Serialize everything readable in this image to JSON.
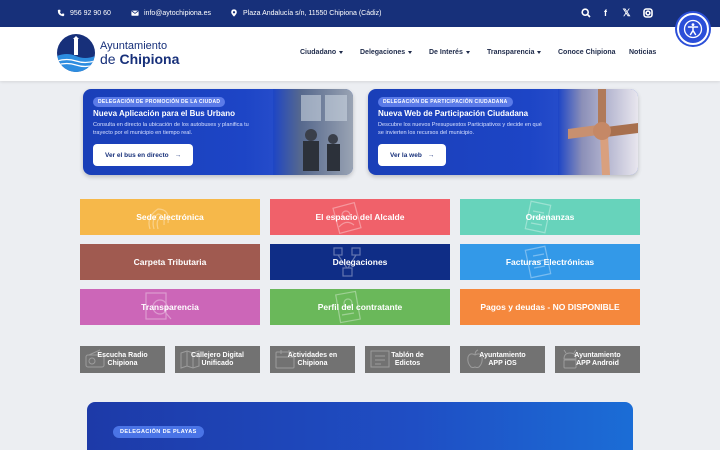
{
  "topbar": {
    "phone": "956 92 90 60",
    "email": "info@aytochipiona.es",
    "address": "Plaza Andalucía s/n, 11550 Chipiona (Cádiz)",
    "icons": [
      "phone-icon",
      "mail-icon",
      "location-icon",
      "search-icon",
      "facebook-icon",
      "x-icon",
      "instagram-icon"
    ]
  },
  "header": {
    "logo_line1": "Ayuntamiento",
    "logo_line2_pre": "de ",
    "logo_line2_bold": "Chipiona",
    "nav": [
      {
        "label": "Ciudadano",
        "has_caret": true
      },
      {
        "label": "Delegaciones",
        "has_caret": true
      },
      {
        "label": "De Interés",
        "has_caret": true
      },
      {
        "label": "Transparencia",
        "has_caret": true
      },
      {
        "label": "Conoce Chipiona",
        "has_caret": false
      },
      {
        "label": "Noticias",
        "has_caret": false
      }
    ]
  },
  "promos": [
    {
      "badge": "DELEGACIÓN DE PROMOCIÓN DE LA CIUDAD",
      "title": "Nueva Aplicación para el Bus Urbano",
      "desc": "Consulta en directo la ubicación de los autobuses y planifica tu trayecto por el municipio en tiempo real.",
      "button": "Ver el bus en directo"
    },
    {
      "badge": "DELEGACIÓN DE PARTICIPACIÓN CIUDADANA",
      "title": "Nueva Web de Participación Ciudadana",
      "desc": "Descubre los nuevos Presupuestos Participativos y decide en qué se invierten los recursos del municipio.",
      "button": "Ver la web"
    }
  ],
  "tiles": [
    {
      "label": "Sede electrónica",
      "color": "#f6b84a"
    },
    {
      "label": "El espacio del Alcalde",
      "color": "#f0616a"
    },
    {
      "label": "Ordenanzas",
      "color": "#67d3bb"
    },
    {
      "label": "Carpeta Tributaria",
      "color": "#a05a50"
    },
    {
      "label": "Delegaciones",
      "color": "#0f2d86"
    },
    {
      "label": "Facturas Electrónicas",
      "color": "#3399e8"
    },
    {
      "label": "Transparencia",
      "color": "#cc66b8"
    },
    {
      "label": "Perfil del contratante",
      "color": "#6ab85a"
    },
    {
      "label": "Pagos y deudas - NO DISPONIBLE",
      "color": "#f5883d"
    }
  ],
  "small_tiles": [
    {
      "line1": "Escucha Radio",
      "line2": "Chipiona"
    },
    {
      "line1": "Callejero Digital",
      "line2": "Unificado"
    },
    {
      "line1": "Actividades en",
      "line2": "Chipiona"
    },
    {
      "line1": "Tablón de",
      "line2": "Edictos"
    },
    {
      "line1": "Ayuntamiento",
      "line2": "APP iOS"
    },
    {
      "line1": "Ayuntamiento",
      "line2": "APP Android"
    }
  ],
  "banner": {
    "badge": "DELEGACIÓN DE PLAYAS"
  },
  "colors": {
    "topbar": "#17307a",
    "accent": "#2b4fd8"
  }
}
